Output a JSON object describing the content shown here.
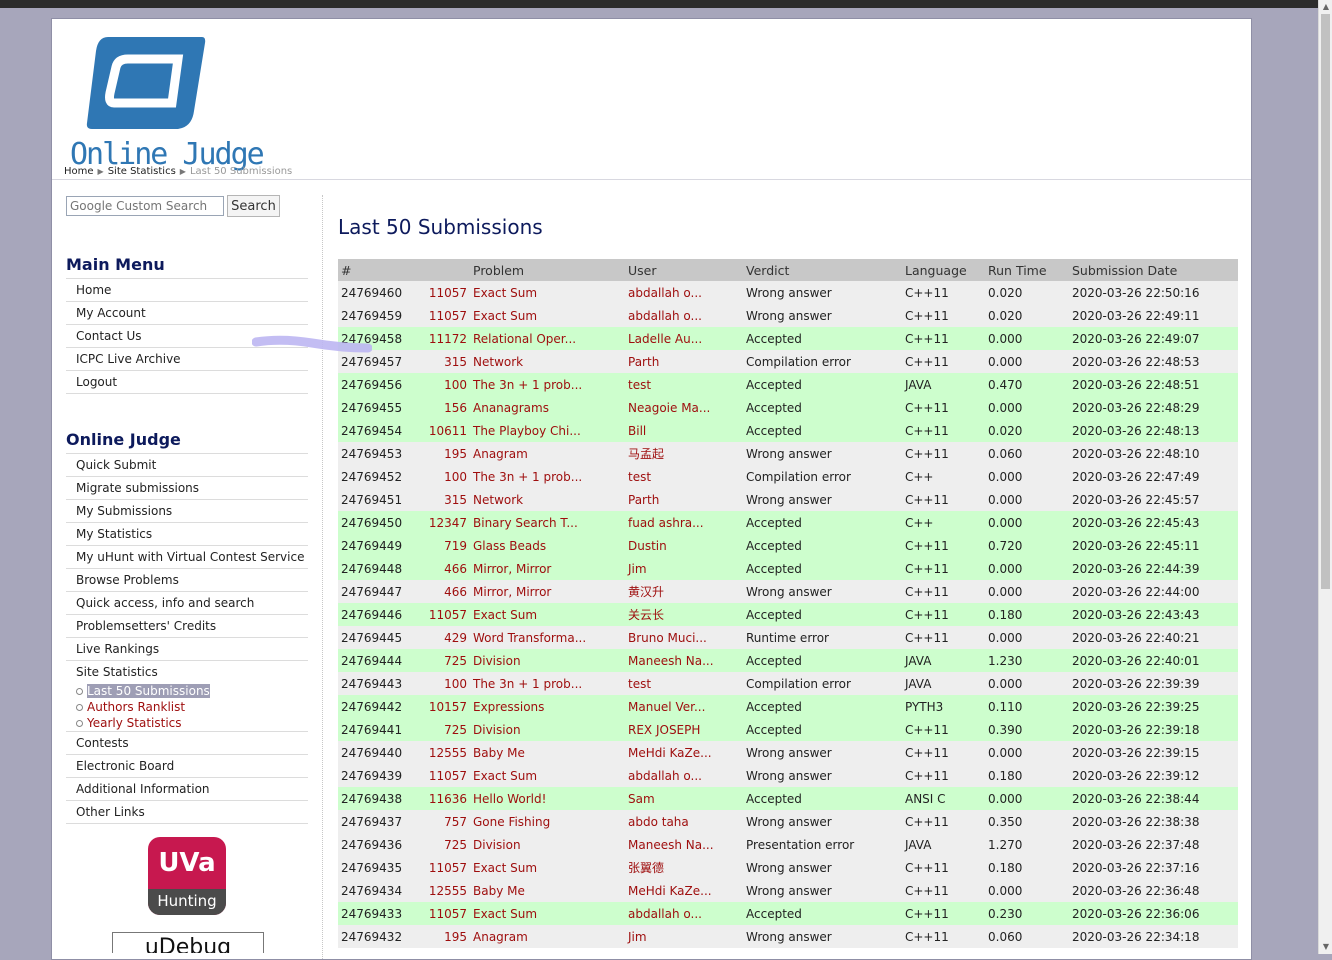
{
  "header": {
    "logo_text": "Online Judge",
    "breadcrumb": [
      "Home",
      "Site Statistics",
      "Last 50 Submissions"
    ]
  },
  "search": {
    "placeholder": "Google Custom Search",
    "button_label": "Search"
  },
  "main_menu": {
    "title": "Main Menu",
    "items": [
      "Home",
      "My Account",
      "Contact Us",
      "ICPC Live Archive",
      "Logout"
    ]
  },
  "oj_menu": {
    "title": "Online Judge",
    "items": [
      "Quick Submit",
      "Migrate submissions",
      "My Submissions",
      "My Statistics",
      "My uHunt with Virtual Contest Service",
      "Browse Problems",
      "Quick access, info and search",
      "Problemsetters' Credits",
      "Live Rankings",
      "Site Statistics"
    ],
    "sub_items": [
      "Last 50 Submissions",
      "Authors Ranklist",
      "Yearly Statistics"
    ],
    "items_after": [
      "Contests",
      "Electronic Board",
      "Additional Information",
      "Other Links"
    ]
  },
  "badge": {
    "top": "UVa",
    "bottom": "Hunting"
  },
  "udebug_text": "uDebug",
  "page_title": "Last 50 Submissions",
  "colors": {
    "accepted": "#cdfecd",
    "other": "#eeeeee",
    "link": "#9e0d0d",
    "heading": "#0d1a5c"
  },
  "table": {
    "headers": [
      "#",
      "",
      "Problem",
      "User",
      "Verdict",
      "Language",
      "Run Time",
      "Submission Date"
    ],
    "rows": [
      [
        "24769460",
        "11057",
        "Exact Sum",
        "abdallah o...",
        "Wrong answer",
        "C++11",
        "0.020",
        "2020-03-26 22:50:16"
      ],
      [
        "24769459",
        "11057",
        "Exact Sum",
        "abdallah o...",
        "Wrong answer",
        "C++11",
        "0.020",
        "2020-03-26 22:49:11"
      ],
      [
        "24769458",
        "11172",
        "Relational Oper...",
        "Ladelle Au...",
        "Accepted",
        "C++11",
        "0.000",
        "2020-03-26 22:49:07"
      ],
      [
        "24769457",
        "315",
        "Network",
        "Parth",
        "Compilation error",
        "C++11",
        "0.000",
        "2020-03-26 22:48:53"
      ],
      [
        "24769456",
        "100",
        "The 3n + 1 prob...",
        "test",
        "Accepted",
        "JAVA",
        "0.470",
        "2020-03-26 22:48:51"
      ],
      [
        "24769455",
        "156",
        "Ananagrams",
        "Neagoie Ma...",
        "Accepted",
        "C++11",
        "0.000",
        "2020-03-26 22:48:29"
      ],
      [
        "24769454",
        "10611",
        "The Playboy Chi...",
        "Bill",
        "Accepted",
        "C++11",
        "0.020",
        "2020-03-26 22:48:13"
      ],
      [
        "24769453",
        "195",
        "Anagram",
        "马孟起",
        "Wrong answer",
        "C++11",
        "0.060",
        "2020-03-26 22:48:10"
      ],
      [
        "24769452",
        "100",
        "The 3n + 1 prob...",
        "test",
        "Compilation error",
        "C++",
        "0.000",
        "2020-03-26 22:47:49"
      ],
      [
        "24769451",
        "315",
        "Network",
        "Parth",
        "Wrong answer",
        "C++11",
        "0.000",
        "2020-03-26 22:45:57"
      ],
      [
        "24769450",
        "12347",
        "Binary Search T...",
        "fuad ashra...",
        "Accepted",
        "C++",
        "0.000",
        "2020-03-26 22:45:43"
      ],
      [
        "24769449",
        "719",
        "Glass Beads",
        "Dustin",
        "Accepted",
        "C++11",
        "0.720",
        "2020-03-26 22:45:11"
      ],
      [
        "24769448",
        "466",
        "Mirror, Mirror",
        "Jim",
        "Accepted",
        "C++11",
        "0.000",
        "2020-03-26 22:44:39"
      ],
      [
        "24769447",
        "466",
        "Mirror, Mirror",
        "黄汉升",
        "Wrong answer",
        "C++11",
        "0.000",
        "2020-03-26 22:44:00"
      ],
      [
        "24769446",
        "11057",
        "Exact Sum",
        "关云长",
        "Accepted",
        "C++11",
        "0.180",
        "2020-03-26 22:43:43"
      ],
      [
        "24769445",
        "429",
        "Word Transforma...",
        "Bruno Muci...",
        "Runtime error",
        "C++11",
        "0.000",
        "2020-03-26 22:40:21"
      ],
      [
        "24769444",
        "725",
        "Division",
        "Maneesh Na...",
        "Accepted",
        "JAVA",
        "1.230",
        "2020-03-26 22:40:01"
      ],
      [
        "24769443",
        "100",
        "The 3n + 1 prob...",
        "test",
        "Compilation error",
        "JAVA",
        "0.000",
        "2020-03-26 22:39:39"
      ],
      [
        "24769442",
        "10157",
        "Expressions",
        "Manuel Ver...",
        "Accepted",
        "PYTH3",
        "0.110",
        "2020-03-26 22:39:25"
      ],
      [
        "24769441",
        "725",
        "Division",
        "REX JOSEPH",
        "Accepted",
        "C++11",
        "0.390",
        "2020-03-26 22:39:18"
      ],
      [
        "24769440",
        "12555",
        "Baby Me",
        "MeHdi KaZe...",
        "Wrong answer",
        "C++11",
        "0.000",
        "2020-03-26 22:39:15"
      ],
      [
        "24769439",
        "11057",
        "Exact Sum",
        "abdallah o...",
        "Wrong answer",
        "C++11",
        "0.180",
        "2020-03-26 22:39:12"
      ],
      [
        "24769438",
        "11636",
        "Hello World!",
        "Sam",
        "Accepted",
        "ANSI C",
        "0.000",
        "2020-03-26 22:38:44"
      ],
      [
        "24769437",
        "757",
        "Gone Fishing",
        "abdo taha",
        "Wrong answer",
        "C++11",
        "0.350",
        "2020-03-26 22:38:38"
      ],
      [
        "24769436",
        "725",
        "Division",
        "Maneesh Na...",
        "Presentation error",
        "JAVA",
        "1.270",
        "2020-03-26 22:37:48"
      ],
      [
        "24769435",
        "11057",
        "Exact Sum",
        "张翼德",
        "Wrong answer",
        "C++11",
        "0.180",
        "2020-03-26 22:37:16"
      ],
      [
        "24769434",
        "12555",
        "Baby Me",
        "MeHdi KaZe...",
        "Wrong answer",
        "C++11",
        "0.000",
        "2020-03-26 22:36:48"
      ],
      [
        "24769433",
        "11057",
        "Exact Sum",
        "abdallah o...",
        "Accepted",
        "C++11",
        "0.230",
        "2020-03-26 22:36:06"
      ],
      [
        "24769432",
        "195",
        "Anagram",
        "Jim",
        "Wrong answer",
        "C++11",
        "0.060",
        "2020-03-26 22:34:18"
      ]
    ]
  }
}
